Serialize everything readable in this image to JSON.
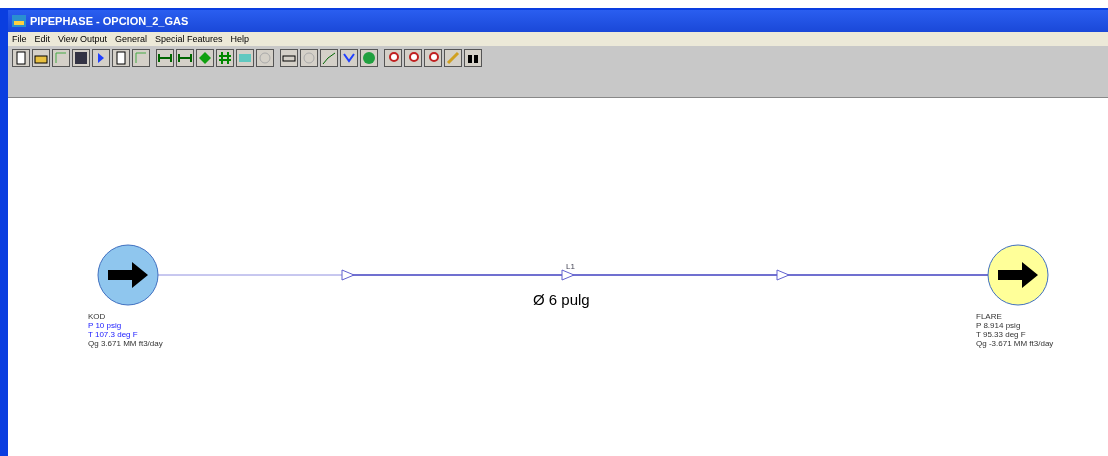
{
  "window": {
    "title": "PIPEPHASE - OPCION_2_GAS"
  },
  "menu": [
    "File",
    "Edit",
    "View Output",
    "General",
    "Special Features",
    "Help"
  ],
  "canvas": {
    "nodes": [
      {
        "kind": "source",
        "name": "KOD",
        "readings": [
          {
            "text": "P 10 psig",
            "specified": true
          },
          {
            "text": "T 107.3 deg F",
            "specified": true
          },
          {
            "text": "Qg 3.671 MM ft3/day",
            "specified": false
          }
        ]
      },
      {
        "kind": "sink",
        "name": "FLARE",
        "readings": [
          {
            "text": "P 8.914 psig",
            "specified": false
          },
          {
            "text": "T 95.33 deg F",
            "specified": false
          },
          {
            "text": "Qg -3.671 MM ft3/day",
            "specified": false
          }
        ]
      }
    ],
    "link": {
      "name": "L1",
      "note": "Ø 6 pulg"
    }
  }
}
